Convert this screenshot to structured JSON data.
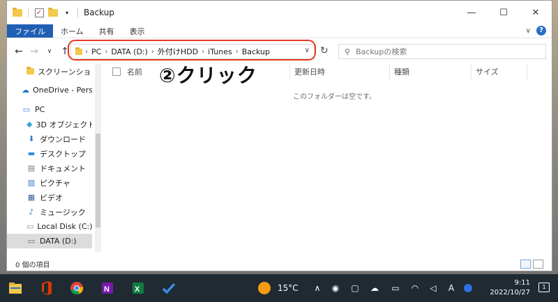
{
  "window": {
    "title": "Backup",
    "controls": {
      "minimize": "—",
      "maximize": "☐",
      "close": "✕"
    }
  },
  "ribbon": {
    "tabs": [
      "ファイル",
      "ホーム",
      "共有",
      "表示"
    ]
  },
  "address": {
    "segments": [
      "PC",
      "DATA (D:)",
      "外付けHDD",
      "iTunes",
      "Backup"
    ],
    "search_placeholder": "Backupの検索"
  },
  "annotation": {
    "label": "②クリック",
    "color": "#e5391f"
  },
  "sidebar": {
    "items": [
      {
        "label": "スクリーンショット",
        "icon": "folder-icon"
      },
      {
        "label": "OneDrive - Person",
        "icon": "cloud-icon"
      },
      {
        "label": "PC",
        "icon": "computer-icon"
      },
      {
        "label": "3D オブジェクト",
        "icon": "3d-objects-icon"
      },
      {
        "label": "ダウンロード",
        "icon": "download-icon"
      },
      {
        "label": "デスクトップ",
        "icon": "desktop-icon"
      },
      {
        "label": "ドキュメント",
        "icon": "documents-icon"
      },
      {
        "label": "ピクチャ",
        "icon": "pictures-icon"
      },
      {
        "label": "ビデオ",
        "icon": "videos-icon"
      },
      {
        "label": "ミュージック",
        "icon": "music-icon"
      },
      {
        "label": "Local Disk (C:)",
        "icon": "drive-icon"
      },
      {
        "label": "DATA (D:)",
        "icon": "drive-icon",
        "selected": true
      }
    ]
  },
  "columns": [
    "名前",
    "更新日時",
    "種類",
    "サイズ"
  ],
  "empty_message": "このフォルダーは空です。",
  "status": {
    "item_count": "0 個の項目"
  },
  "taskbar": {
    "weather": "15°C",
    "time": "9:11",
    "date": "2022/10/27",
    "notifications": "1"
  }
}
